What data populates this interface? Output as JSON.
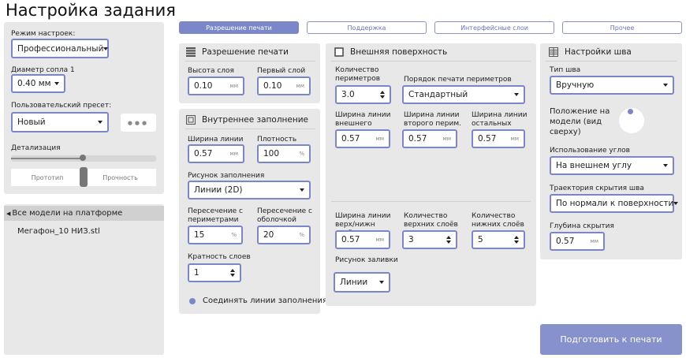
{
  "title": "Настройка задания",
  "tabs": [
    "Разрешение печати",
    "Поддержка",
    "Интерфейсные слои",
    "Прочее"
  ],
  "left": {
    "mode_label": "Режим настроек:",
    "mode_value": "Профессиональный",
    "nozzle_label": "Диаметр сопла 1",
    "nozzle_value": "0.40 мм",
    "preset_label": "Пользовательский пресет:",
    "preset_value": "Новый",
    "more": "●●●",
    "detail_label": "Детализация",
    "detail_left": "Прототип",
    "detail_right": "Прочность",
    "tree_root": "Все модели на платформе",
    "tree_child": "Мегафон_10 НИЗ.stl"
  },
  "res": {
    "title": "Разрешение печати",
    "layer_label": "Высота слоя",
    "layer_value": "0.10",
    "layer_unit": "мм",
    "first_label": "Первый слой",
    "first_value": "0.10",
    "first_unit": "мм"
  },
  "infill": {
    "title": "Внутреннее заполнение",
    "line_label": "Ширина линии",
    "line_value": "0.57",
    "line_unit": "мм",
    "density_label": "Плотность",
    "density_value": "100",
    "density_unit": "%",
    "pattern_label": "Рисунок заполнения",
    "pattern_value": "Линии (2D)",
    "overlap_p_label": "Пересечение с периметрами",
    "overlap_p_value": "15",
    "overlap_p_unit": "%",
    "overlap_s_label": "Пересечение с оболочкой",
    "overlap_s_value": "20",
    "overlap_s_unit": "%",
    "mult_label": "Кратность слоев",
    "mult_value": "1",
    "connect_label": "Соединять линии заполнения"
  },
  "outer": {
    "title": "Внешняя поверхность",
    "count_label": "Количество периметров",
    "count_value": "3.0",
    "order_label": "Порядок печати периметров",
    "order_value": "Стандартный",
    "w_ext_label": "Ширина линии внешнего перим.",
    "w_ext_value": "0.57",
    "w_ext_unit": "мм",
    "w_sec_label": "Ширина линии второго перим.",
    "w_sec_value": "0.57",
    "w_sec_unit": "мм",
    "w_rest_label": "Ширина линии остальных перим.",
    "w_rest_value": "0.57",
    "w_rest_unit": "мм",
    "w_tb_label": "Ширина линии верх/нижн слоёв",
    "w_tb_value": "0.57",
    "w_tb_unit": "мм",
    "top_label": "Количество верхних слоёв",
    "top_value": "3",
    "bot_label": "Количество нижних слоёв",
    "bot_value": "5",
    "fill_label": "Рисунок заливки",
    "fill_value": "Линии"
  },
  "seam": {
    "title": "Настройки шва",
    "type_label": "Тип шва",
    "type_value": "Вручную",
    "pos_label": "Положение на модели (вид сверху)",
    "corner_label": "Использование углов",
    "corner_value": "На внешнем углу",
    "traj_label": "Траектория скрытия шва",
    "traj_value": "По нормали к поверхности",
    "depth_label": "Глубина скрытия",
    "depth_value": "0.57",
    "depth_unit": "мм"
  },
  "prepare": "Подготовить к печати",
  "colors": {
    "accent": "#7b87c9",
    "button": "#8792cc",
    "panel": "#e8e8e8"
  }
}
